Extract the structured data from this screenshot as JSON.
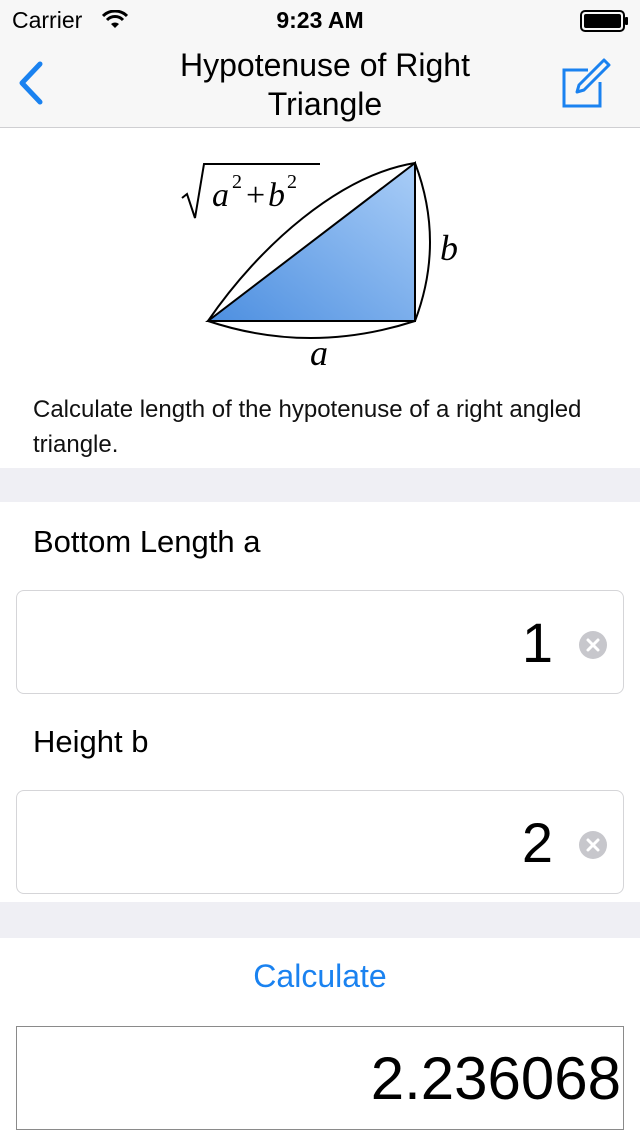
{
  "status_bar": {
    "carrier": "Carrier",
    "time": "9:23 AM",
    "wifi_icon": "wifi-icon",
    "battery_icon": "battery-icon"
  },
  "nav": {
    "title": "Hypotenuse of Right Triangle",
    "back_icon": "chevron-left-icon",
    "edit_icon": "compose-icon",
    "tint_color": "#1a82f0"
  },
  "diagram": {
    "formula_base_a": "a",
    "formula_exp": "2",
    "formula_plus": "+",
    "formula_base_b": "b",
    "label_a": "a",
    "label_b": "b",
    "fill_color": "#5a9ae0"
  },
  "description": "Calculate length of the hypotenuse of a right angled triangle.",
  "fields": [
    {
      "label": "Bottom Length a",
      "value": "1"
    },
    {
      "label": "Height b",
      "value": "2"
    }
  ],
  "calculate_label": "Calculate",
  "result": "2.236068",
  "colors": {
    "accent": "#1a82f0",
    "section_background": "#efeff4"
  }
}
